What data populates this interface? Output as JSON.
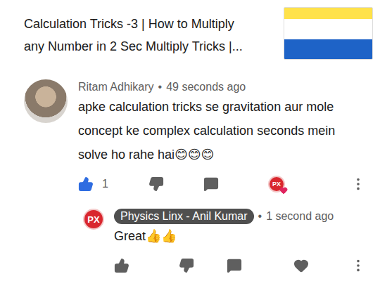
{
  "video": {
    "title_lines": [
      "Calculation Tricks -3 | How to Multiply",
      "any Number in 2 Sec Multiply Tricks |..."
    ]
  },
  "comment": {
    "author": "Ritam Adhikary",
    "separator": "•",
    "time": "49 seconds ago",
    "text": "apke calculation tricks se gravitation aur mole concept ke complex calculation seconds mein solve ho rahe hai😊😊😊",
    "likes": "1",
    "liked": true,
    "hearted_by_creator": true
  },
  "reply": {
    "author": "Physics Linx - Anil Kumar",
    "is_creator": true,
    "separator": "•",
    "time": "1 second ago",
    "text": "Great👍👍",
    "liked": false,
    "hearted": false
  },
  "channel": {
    "logo": "PX"
  }
}
